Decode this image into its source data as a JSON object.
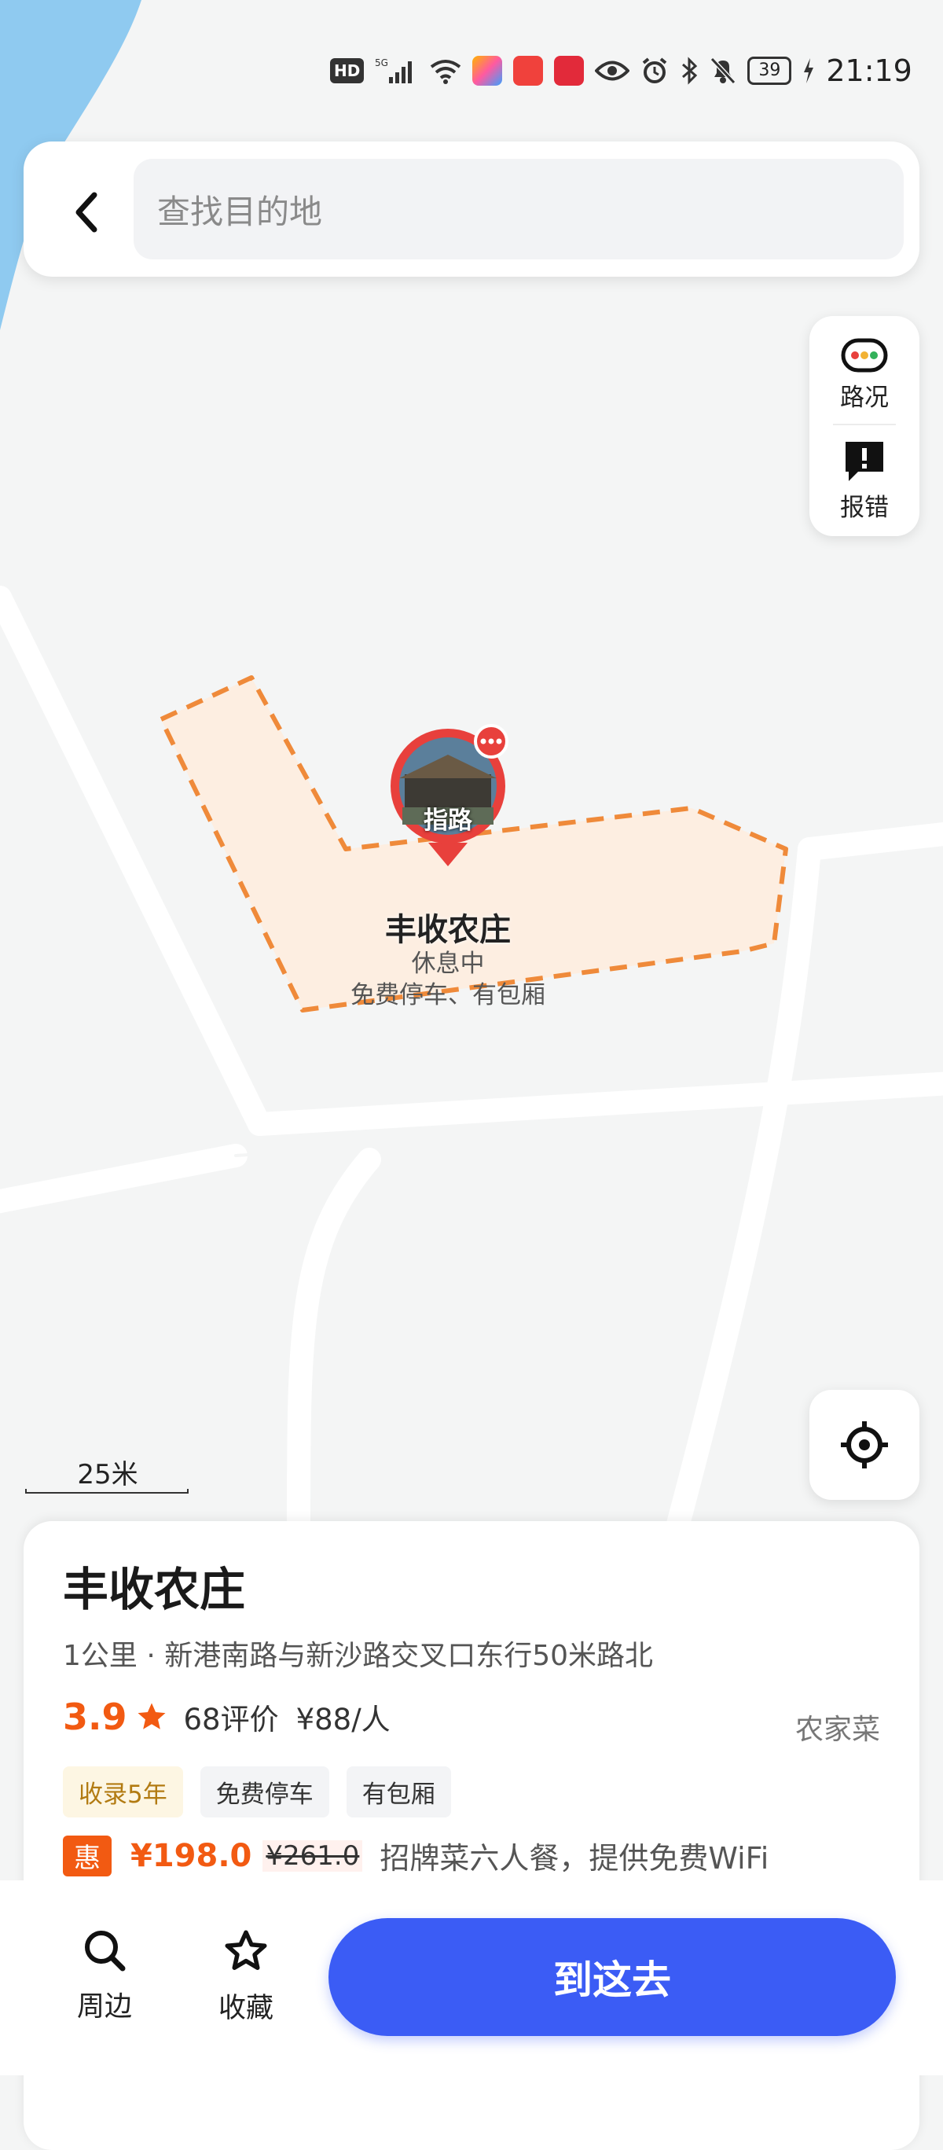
{
  "status_bar": {
    "hd": "HD",
    "network": "5G",
    "battery": "39",
    "time": "21:19"
  },
  "search": {
    "placeholder": "查找目的地"
  },
  "map_tools": {
    "traffic_label": "路况",
    "report_label": "报错"
  },
  "scale": {
    "label": "25米"
  },
  "map_marker": {
    "badge_label": "指路",
    "name": "丰收农庄",
    "status": "休息中",
    "tags": "免费停车、有包厢"
  },
  "place_card": {
    "title": "丰收农庄",
    "distance_address": "1公里 · 新港南路与新沙路交叉口东行50米路北",
    "rating": "3.9",
    "reviews": "68评价",
    "avg_price": "¥88/人",
    "category": "农家菜",
    "tags": [
      "收录5年",
      "免费停车",
      "有包厢"
    ],
    "deal": {
      "badge": "惠",
      "price": "¥198.0",
      "original_price": "¥261.0",
      "description": "招牌菜六人餐，提供免费WiFi"
    }
  },
  "bottom_bar": {
    "nearby_label": "周边",
    "favorite_label": "收藏",
    "go_label": "到这去"
  },
  "colors": {
    "accent": "#3b5cf5",
    "orange": "#f25a12",
    "marker_red": "#e8403c",
    "area_fill": "#fdeee1",
    "area_border": "#ef8a3a",
    "water": "#8fcaf0"
  }
}
